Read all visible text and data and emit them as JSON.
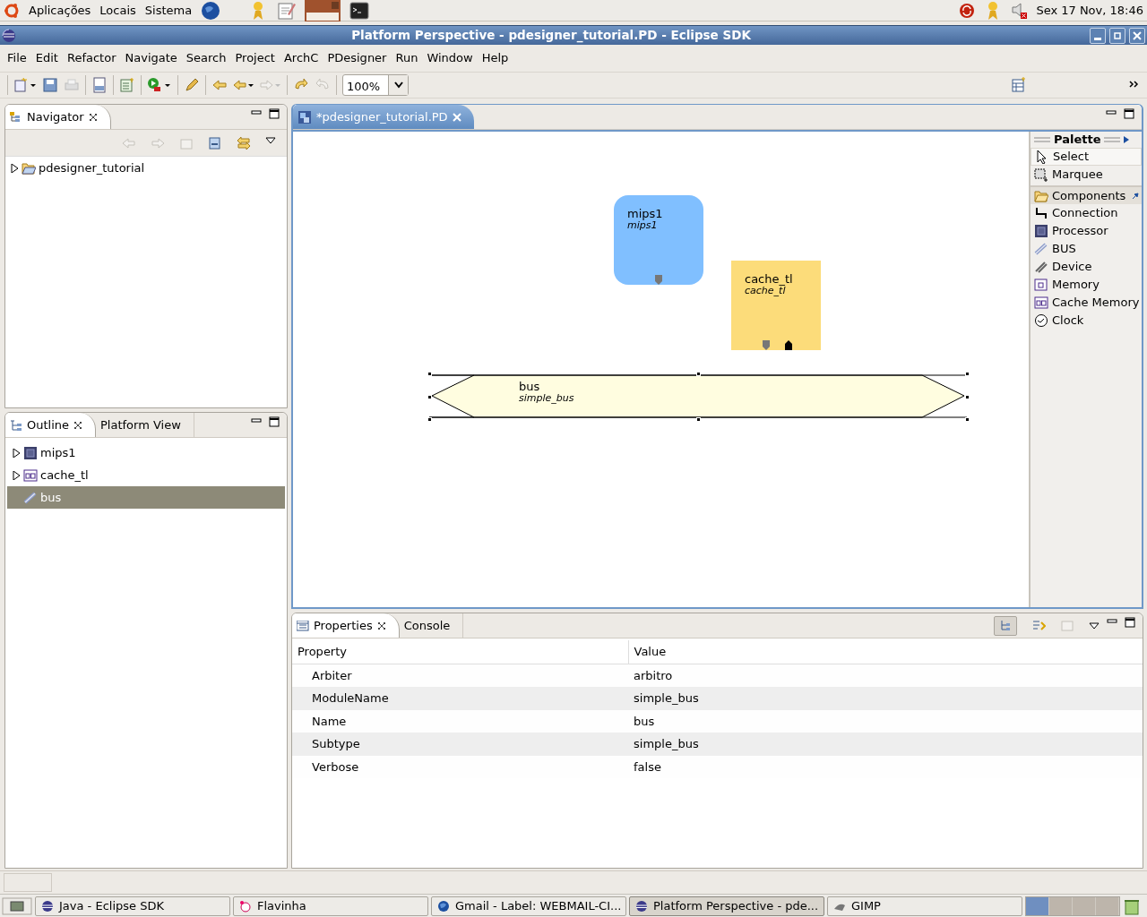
{
  "top_panel": {
    "menus": [
      "Aplicações",
      "Locais",
      "Sistema"
    ],
    "clock": "Sex 17 Nov, 18:46"
  },
  "window": {
    "title": "Platform Perspective - pdesigner_tutorial.PD - Eclipse SDK"
  },
  "menu": [
    "File",
    "Edit",
    "Refactor",
    "Navigate",
    "Search",
    "Project",
    "ArchC",
    "PDesigner",
    "Run",
    "Window",
    "Help"
  ],
  "toolbar": {
    "zoom": "100%"
  },
  "navigator": {
    "tab": "Navigator",
    "tree": [
      {
        "label": "pdesigner_tutorial",
        "expanded": false
      }
    ]
  },
  "outline": {
    "tabs": [
      {
        "label": "Outline",
        "selected": true
      },
      {
        "label": "Platform View",
        "selected": false
      }
    ],
    "tree": [
      {
        "label": "mips1",
        "kind": "processor",
        "expanded": false,
        "selected": false
      },
      {
        "label": "cache_tl",
        "kind": "cache",
        "expanded": false,
        "selected": false
      },
      {
        "label": "bus",
        "kind": "bus",
        "selected": true
      }
    ]
  },
  "editor": {
    "tab": "*pdesigner_tutorial.PD",
    "nodes": [
      {
        "kind": "processor",
        "name": "mips1",
        "type": "mips1",
        "selected": false
      },
      {
        "kind": "cache",
        "name": "cache_tl",
        "type": "cache_tl",
        "selected": false
      },
      {
        "kind": "bus",
        "name": "bus",
        "type": "simple_bus",
        "selected": true
      }
    ]
  },
  "palette": {
    "title": "Palette",
    "tools": [
      {
        "label": "Select",
        "kind": "select",
        "selected": true
      },
      {
        "label": "Marquee",
        "kind": "marquee",
        "selected": false
      }
    ],
    "drawer": "Components",
    "items": [
      {
        "label": "Connection",
        "kind": "connection"
      },
      {
        "label": "Processor",
        "kind": "processor"
      },
      {
        "label": "BUS",
        "kind": "bus"
      },
      {
        "label": "Device",
        "kind": "device"
      },
      {
        "label": "Memory",
        "kind": "memory"
      },
      {
        "label": "Cache Memory",
        "kind": "cache"
      },
      {
        "label": "Clock",
        "kind": "clock"
      }
    ]
  },
  "properties": {
    "tabs": [
      {
        "label": "Properties",
        "selected": true
      },
      {
        "label": "Console",
        "selected": false
      }
    ],
    "columns": [
      "Property",
      "Value"
    ],
    "rows": [
      [
        "Arbiter",
        "arbitro"
      ],
      [
        "ModuleName",
        "simple_bus"
      ],
      [
        "Name",
        "bus"
      ],
      [
        "Subtype",
        "simple_bus"
      ],
      [
        "Verbose",
        "false"
      ]
    ]
  },
  "taskbar": [
    {
      "label": "Java - Eclipse SDK",
      "selected": false
    },
    {
      "label": "Flavinha",
      "selected": false
    },
    {
      "label": "Gmail - Label: WEBMAIL-CI...",
      "selected": false
    },
    {
      "label": "Platform Perspective - pde...",
      "selected": true
    },
    {
      "label": "GIMP",
      "selected": false
    }
  ]
}
